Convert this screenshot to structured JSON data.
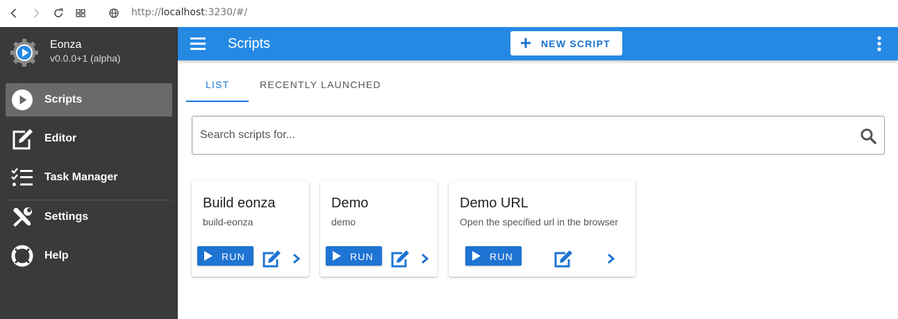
{
  "browser": {
    "url_prefix": "http://",
    "url_host": "localhost",
    "url_rest": ":3230/#/"
  },
  "sidebar": {
    "app_name": "Eonza",
    "app_version": "v0.0.0+1 (alpha)",
    "items": [
      {
        "label": "Scripts",
        "icon": "play-circle-icon",
        "active": true
      },
      {
        "label": "Editor",
        "icon": "edit-icon"
      },
      {
        "label": "Task Manager",
        "icon": "tasks-icon"
      },
      {
        "label": "Settings",
        "icon": "tools-icon"
      },
      {
        "label": "Help",
        "icon": "lifebuoy-icon"
      }
    ]
  },
  "appbar": {
    "title": "Scripts",
    "new_script_label": "NEW SCRIPT"
  },
  "tabs": [
    {
      "label": "LIST",
      "active": true
    },
    {
      "label": "RECENTLY LAUNCHED"
    }
  ],
  "search": {
    "placeholder": "Search scripts for..."
  },
  "cards": [
    {
      "title": "Build eonza",
      "subtitle": "build-eonza",
      "run_label": "RUN"
    },
    {
      "title": "Demo",
      "subtitle": "demo",
      "run_label": "RUN"
    },
    {
      "title": "Demo URL",
      "subtitle": "Open the specified url in the browser",
      "run_label": "RUN"
    }
  ],
  "colors": {
    "accent": "#2589e4",
    "sidebar_bg": "#3a3a3a",
    "primary_button": "#1e74d2"
  }
}
